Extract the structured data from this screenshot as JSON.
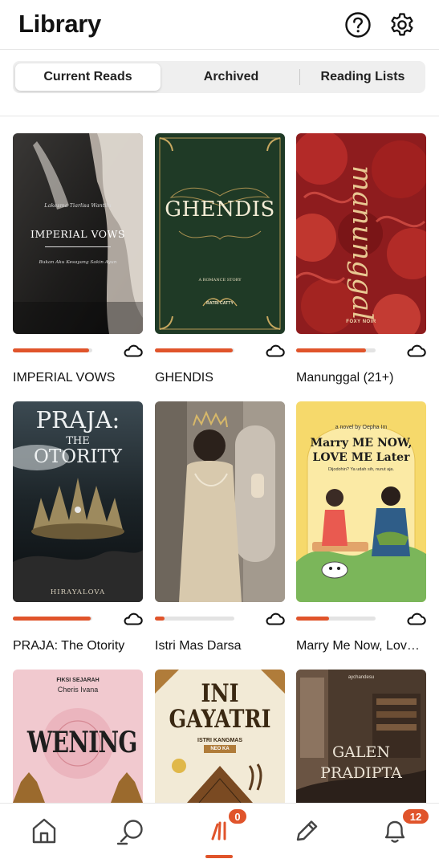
{
  "header": {
    "title": "Library",
    "help_icon": "help-icon",
    "settings_icon": "gear-icon"
  },
  "tabs": [
    {
      "label": "Current Reads",
      "active": true
    },
    {
      "label": "Archived",
      "active": false
    },
    {
      "label": "Reading Lists",
      "active": false
    }
  ],
  "accent_color": "#e0542b",
  "books": [
    {
      "title": "IMPERIAL VOWS",
      "progress": 0.96,
      "cover_text": "IMPERIAL VOWS",
      "cover_small_top": "Lakesma Tiarlisa Wantilu",
      "cover_small_bottom": "Bukan Aku Kesayang Sakin Ayun"
    },
    {
      "title": "GHENDIS",
      "progress": 0.98,
      "cover_text": "GHENDIS",
      "cover_sub": "A ROMANCE STORY",
      "cover_author": "RATRI CATTY"
    },
    {
      "title": "Manunggal (21+)",
      "progress": 0.88,
      "cover_text": "manunggal",
      "cover_author": "FOXY NOIR"
    },
    {
      "title": "PRAJA: The Otority",
      "progress": 0.98,
      "cover_text_1": "PRAJA:",
      "cover_text_2": "THE",
      "cover_text_3": "OTORITY",
      "cover_author": "HIRAYALOVA"
    },
    {
      "title": "Istri Mas Darsa",
      "progress": 0.12,
      "cover_text": ""
    },
    {
      "title": "Marry Me Now, Love…",
      "progress": 0.41,
      "cover_top": "a novel by Oepha Im",
      "cover_line1": "Marry ME NOW,",
      "cover_line2": "LOVE ME Later",
      "cover_sub": "Dijodohin? Ya udah sih, nurut aja."
    },
    {
      "title": "",
      "progress": 0,
      "cover_top": "FIKSI SEJARAH",
      "cover_author": "Cheris Ivana",
      "cover_text": "WENING"
    },
    {
      "title": "",
      "progress": 0,
      "cover_text_1": "INI",
      "cover_text_2": "GAYATRI",
      "cover_sub": "ISTRI KANGMAS",
      "cover_author": "NEO KA"
    },
    {
      "title": "",
      "progress": 0,
      "cover_top": "aychandesu",
      "cover_text_1": "GALEN",
      "cover_text_2": "PRADIPTA"
    }
  ],
  "bottom_nav": {
    "items": [
      "home-icon",
      "search-icon",
      "library-icon",
      "write-icon",
      "notifications-icon"
    ],
    "library_badge": "0",
    "notifications_badge": "12"
  }
}
